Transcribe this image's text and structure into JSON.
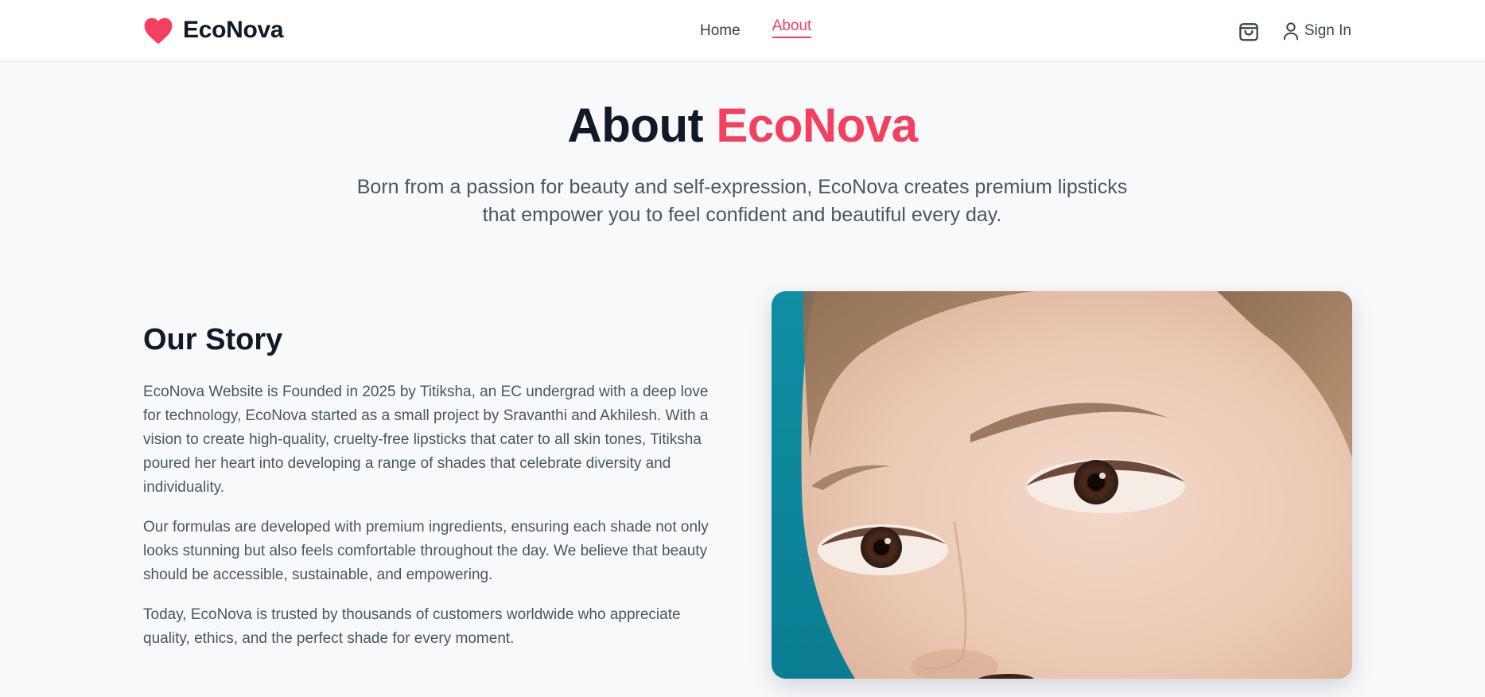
{
  "brand": {
    "name": "EcoNova",
    "accent_color": "#f43f5e",
    "logo_icon": "heart-icon"
  },
  "nav": {
    "links": [
      {
        "label": "Home",
        "active": false
      },
      {
        "label": "About",
        "active": true
      }
    ],
    "cart_icon": "shopping-bag-icon",
    "signin_icon": "user-icon",
    "signin_label": "Sign In"
  },
  "hero": {
    "title_part1": "About",
    "title_part2": "EcoNova",
    "subtitle_line1": "Born from a passion for beauty and self-expression, EcoNova creates premium lipsticks",
    "subtitle_line2": "that empower you to feel confident and beautiful every day."
  },
  "story": {
    "title": "Our Story",
    "paragraphs": [
      "EcoNova Website is Founded in 2025 by Titiksha, an EC undergrad with a deep love for technology, EcoNova started as a small project by Sravanthi and Akhilesh. With a vision to create high-quality, cruelty-free lipsticks that cater to all skin tones, Titiksha poured her heart into developing a range of shades that celebrate diversity and individuality.",
      "Our formulas are developed with premium ingredients, ensuring each shade not only looks stunning but also feels comfortable throughout the day. We believe that beauty should be accessible, sustainable, and empowering.",
      "Today, EcoNova is trusted by thousands of customers worldwide who appreciate quality, ethics, and the perfect shade for every moment."
    ]
  }
}
